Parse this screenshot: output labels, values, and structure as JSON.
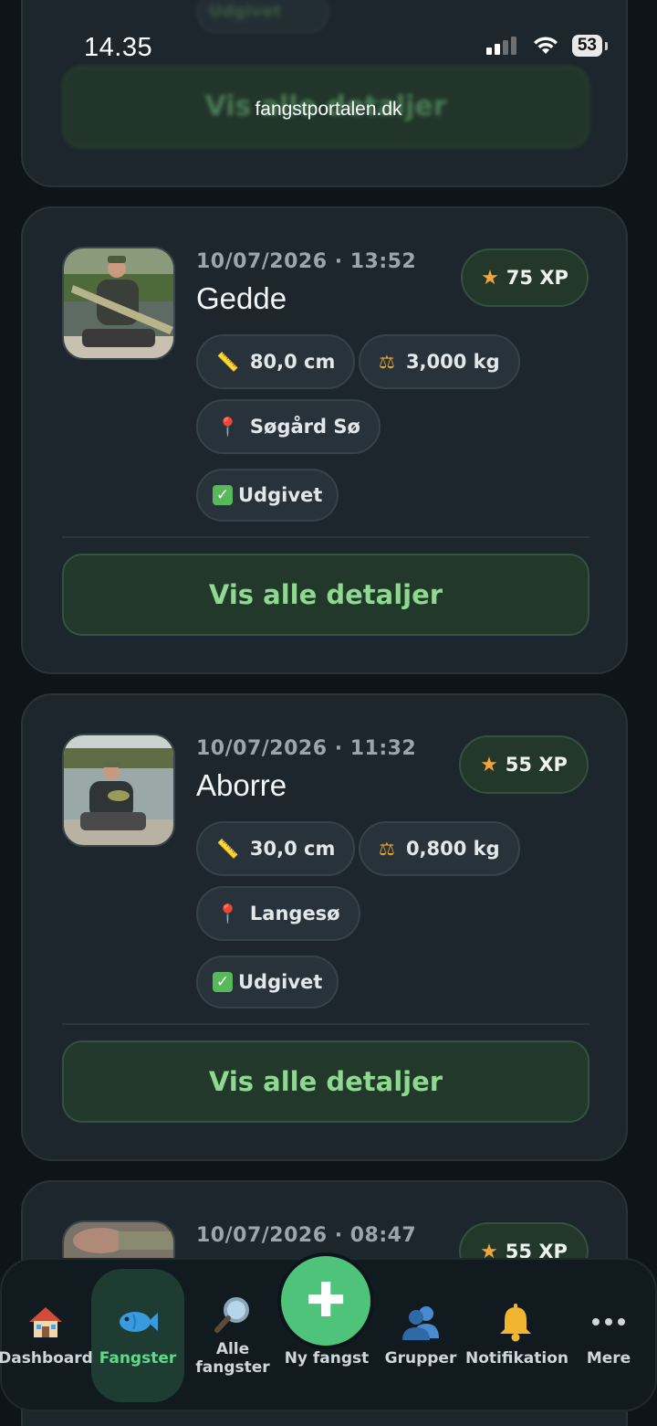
{
  "status_bar": {
    "time": "14.35",
    "battery": "53",
    "url": "fangstportalen.dk"
  },
  "top_card": {
    "badge_label": "Udgivet",
    "button_label": "Vis alle detaljer"
  },
  "catches": [
    {
      "datetime": "10/07/2026 · 13:52",
      "species": "Gedde",
      "xp": "75 XP",
      "length": "80,0 cm",
      "weight": "3,000 kg",
      "location": "Søgård Sø",
      "status": "Udgivet",
      "button_label": "Vis alle detaljer"
    },
    {
      "datetime": "10/07/2026 · 11:32",
      "species": "Aborre",
      "xp": "55 XP",
      "length": "30,0 cm",
      "weight": "0,800 kg",
      "location": "Langesø",
      "status": "Udgivet",
      "button_label": "Vis alle detaljer"
    },
    {
      "datetime": "10/07/2026 · 08:47",
      "xp": "55 XP"
    }
  ],
  "bottom_nav": {
    "items": [
      {
        "label": "Dashboard",
        "icon": "house-icon"
      },
      {
        "label": "Fangster",
        "icon": "fish-icon",
        "active": true
      },
      {
        "label": "Alle fangster",
        "icon": "magnifier-icon"
      },
      {
        "label": "Ny fangst",
        "icon": "plus-icon"
      },
      {
        "label": "Grupper",
        "icon": "people-icon"
      },
      {
        "label": "Notifikation",
        "icon": "bell-icon"
      },
      {
        "label": "Mere",
        "icon": "more-dots-icon"
      }
    ]
  },
  "colors": {
    "accent_green": "#4fc37a",
    "button_text_green": "#8ed88f",
    "star": "#f2a63a",
    "card_bg": "#1c262c"
  }
}
